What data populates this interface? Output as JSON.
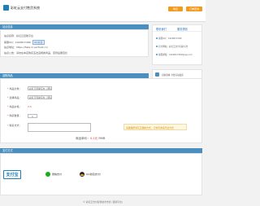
{
  "header": {
    "title": "彩虹云支付售货系统",
    "pay_button": "购买",
    "record_button": "订单查询"
  },
  "site_info": {
    "heading": "站点信息",
    "rows": [
      {
        "label": "站点名称：",
        "value": "彩虹云自助平台"
      },
      {
        "label": "客服QQ：",
        "value": "1926817289",
        "badge": "QQ交谈"
      },
      {
        "label": "站点地址：",
        "value": "https://faka.m.aerhost.cn/"
      },
      {
        "label": "站点公告：",
        "value": "请勿在本店购买违法违规类商品，否则后果自负"
      }
    ]
  },
  "side_box": {
    "tab1": "联系我们",
    "tab2": "服务规则",
    "items": [
      {
        "label": "客服QQ：",
        "value": "1926817289"
      },
      {
        "label": "官方网站：",
        "value": "彩虹云支付自助平台"
      },
      {
        "label": "客服邮箱：",
        "value": "1926817289@qq.com"
      }
    ]
  },
  "side_link": {
    "text": "自助商城·卡密自动发货"
  },
  "product": {
    "heading": "选购商品",
    "category_label": "商品分类：",
    "category_value": "彩虹云自助平台（测试）",
    "product_label": "选择商品：",
    "product_value": "彩虹云自助平台（测试）",
    "price_label": "商品价格：",
    "price_value": "2.5",
    "qty_label": "购买数量：",
    "qty_value": "1",
    "remark_label": "联系方式：",
    "notice_text": "请确保所填写正确的方式，订单查询请凭此方式",
    "unit_price_prefix": "商品单价：",
    "unit_price_value": "0.1元",
    "unit_price_suffix": " RMB"
  },
  "payment": {
    "heading": "支付方式",
    "alipay": "支付宝",
    "wechat": "微信支付",
    "qq": "QQ钱包支付！"
  },
  "footer": {
    "text": "© 彩虹云支付提供技术支持 (自助平台)"
  }
}
